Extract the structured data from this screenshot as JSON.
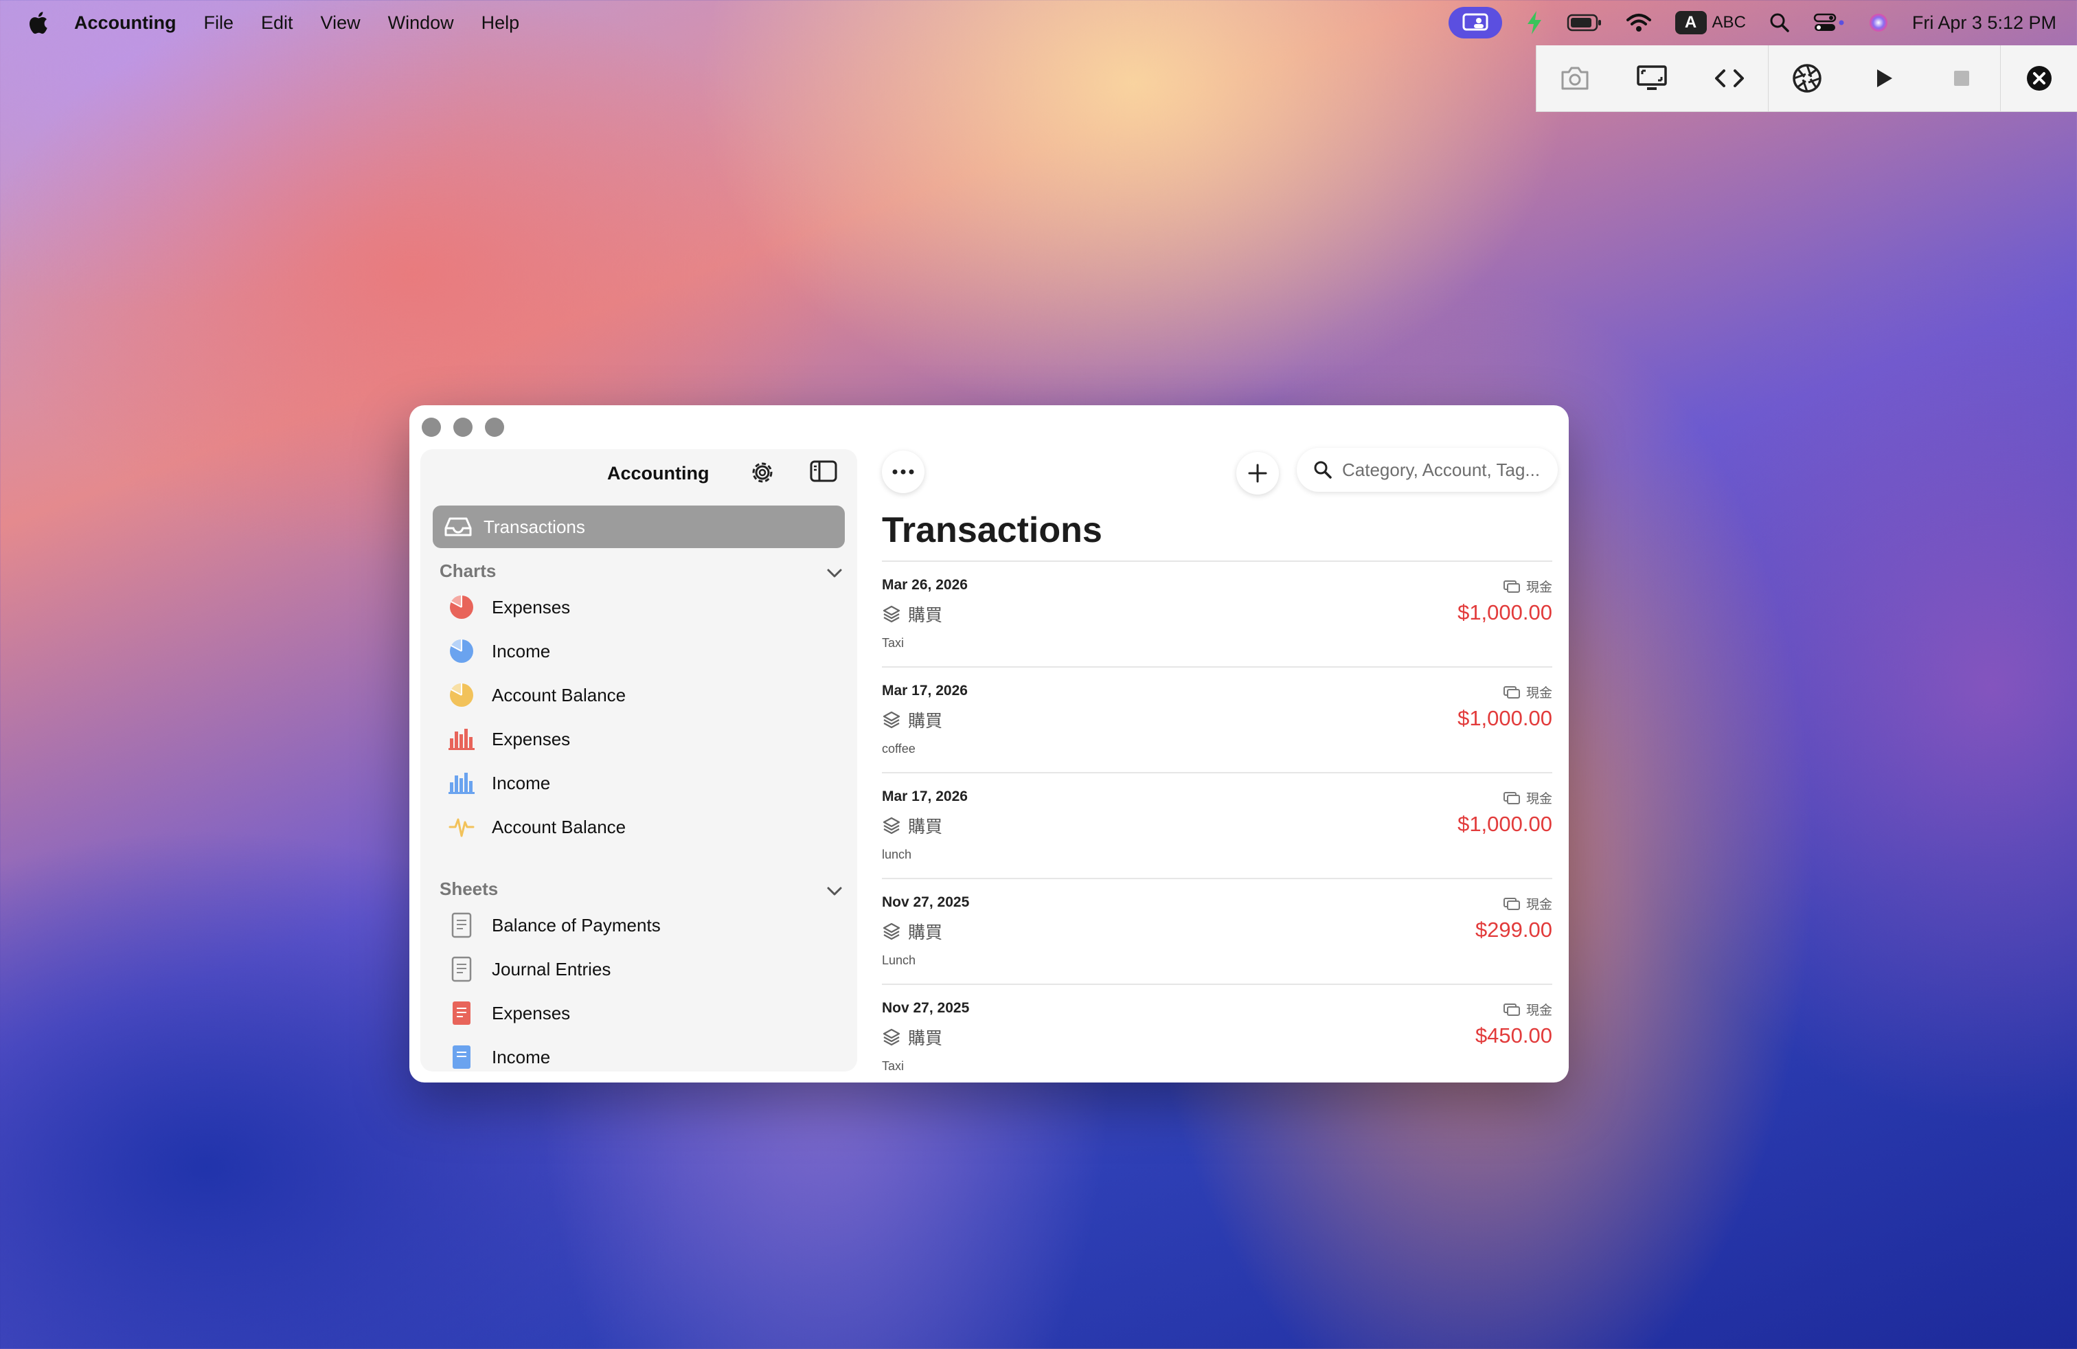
{
  "menubar": {
    "app_name": "Accounting",
    "menus": [
      "File",
      "Edit",
      "View",
      "Window",
      "Help"
    ],
    "input_source": "A",
    "input_label": "ABC",
    "clock": "Fri Apr 3  5:12 PM"
  },
  "capture_toolbar": {
    "buttons": [
      "camera-icon",
      "display-icon",
      "code-icon",
      "aperture-icon",
      "play-icon",
      "stop-icon",
      "close-icon"
    ]
  },
  "sidebar": {
    "title": "Accounting",
    "selected": "Transactions",
    "charts_header": "Charts",
    "charts": [
      {
        "label": "Expenses",
        "icon": "pie-chart-icon",
        "color": "#e8645a"
      },
      {
        "label": "Income",
        "icon": "pie-chart-icon",
        "color": "#6aa3ef"
      },
      {
        "label": "Account Balance",
        "icon": "pie-chart-icon",
        "color": "#f2c25a"
      },
      {
        "label": "Expenses",
        "icon": "bar-chart-icon",
        "color": "#e8645a"
      },
      {
        "label": "Income",
        "icon": "bar-chart-icon",
        "color": "#6aa3ef"
      },
      {
        "label": "Account Balance",
        "icon": "waveform-icon",
        "color": "#f2c25a"
      }
    ],
    "sheets_header": "Sheets",
    "sheets": [
      {
        "label": "Balance of Payments",
        "icon": "document-icon",
        "color": "#8a8a8a"
      },
      {
        "label": "Journal Entries",
        "icon": "document-icon",
        "color": "#8a8a8a"
      },
      {
        "label": "Expenses",
        "icon": "document-icon",
        "color": "#e8645a"
      },
      {
        "label": "Income",
        "icon": "document-icon",
        "color": "#6aa3ef"
      }
    ]
  },
  "main": {
    "title": "Transactions",
    "search_placeholder": "Category, Account, Tag...",
    "transactions": [
      {
        "date": "Mar 26, 2026",
        "category": "購買",
        "note": "Taxi",
        "account": "現金",
        "amount": "$1,000.00"
      },
      {
        "date": "Mar 17, 2026",
        "category": "購買",
        "note": "coffee",
        "account": "現金",
        "amount": "$1,000.00"
      },
      {
        "date": "Mar 17, 2026",
        "category": "購買",
        "note": "lunch",
        "account": "現金",
        "amount": "$1,000.00"
      },
      {
        "date": "Nov 27, 2025",
        "category": "購買",
        "note": "Lunch",
        "account": "現金",
        "amount": "$299.00"
      },
      {
        "date": "Nov 27, 2025",
        "category": "購買",
        "note": "Taxi",
        "account": "現金",
        "amount": "$450.00"
      }
    ]
  },
  "colors": {
    "accent_red": "#e23b3b",
    "selection": "#9c9c9c",
    "rec_badge": "#5b4fe0"
  }
}
